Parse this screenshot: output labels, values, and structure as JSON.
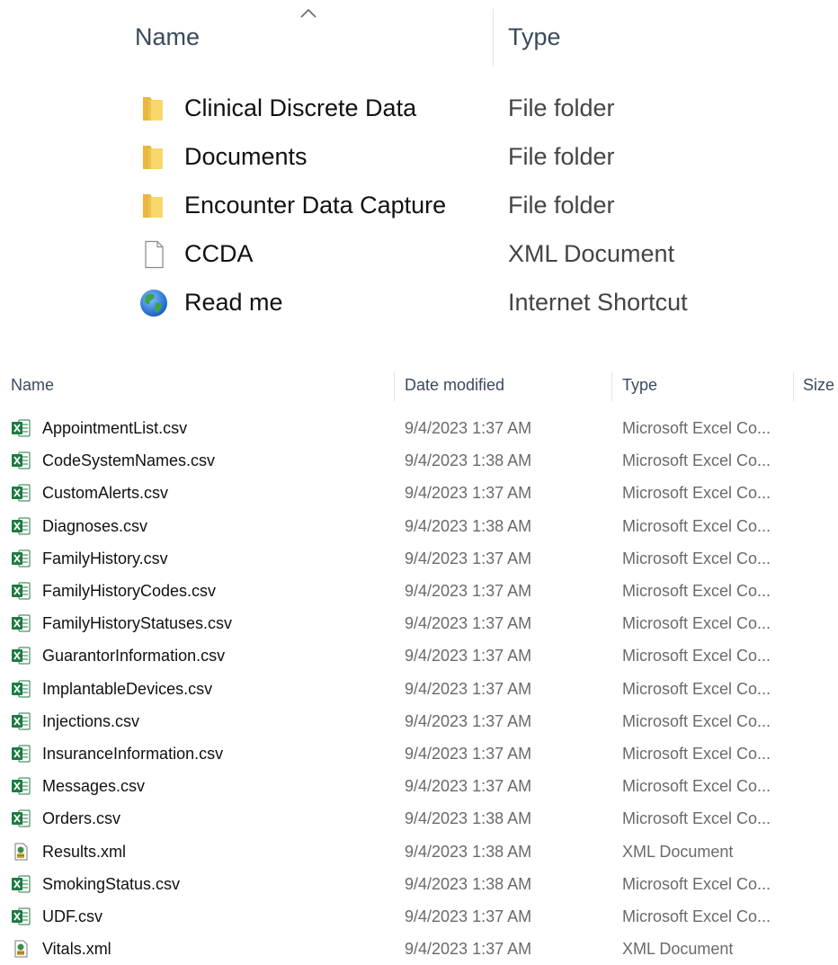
{
  "top_pane": {
    "columns": {
      "name": "Name",
      "type": "Type"
    },
    "sort_icon": "chevron-up-icon",
    "items": [
      {
        "name": "Clinical Discrete Data",
        "type": "File folder",
        "icon": "folder-icon"
      },
      {
        "name": "Documents",
        "type": "File folder",
        "icon": "folder-icon"
      },
      {
        "name": "Encounter Data Capture",
        "type": "File folder",
        "icon": "folder-icon"
      },
      {
        "name": "CCDA",
        "type": "XML Document",
        "icon": "blank-file-icon"
      },
      {
        "name": "Read me",
        "type": "Internet Shortcut",
        "icon": "globe-icon"
      }
    ]
  },
  "bottom_pane": {
    "columns": {
      "name": "Name",
      "date_modified": "Date modified",
      "type": "Type",
      "size": "Size"
    },
    "files": [
      {
        "name": "AppointmentList.csv",
        "date": "9/4/2023 1:37 AM",
        "type": "Microsoft Excel Co...",
        "icon": "excel-csv-icon"
      },
      {
        "name": "CodeSystemNames.csv",
        "date": "9/4/2023 1:38 AM",
        "type": "Microsoft Excel Co...",
        "icon": "excel-csv-icon"
      },
      {
        "name": "CustomAlerts.csv",
        "date": "9/4/2023 1:37 AM",
        "type": "Microsoft Excel Co...",
        "icon": "excel-csv-icon"
      },
      {
        "name": "Diagnoses.csv",
        "date": "9/4/2023 1:38 AM",
        "type": "Microsoft Excel Co...",
        "icon": "excel-csv-icon"
      },
      {
        "name": "FamilyHistory.csv",
        "date": "9/4/2023 1:37 AM",
        "type": "Microsoft Excel Co...",
        "icon": "excel-csv-icon"
      },
      {
        "name": "FamilyHistoryCodes.csv",
        "date": "9/4/2023 1:37 AM",
        "type": "Microsoft Excel Co...",
        "icon": "excel-csv-icon"
      },
      {
        "name": "FamilyHistoryStatuses.csv",
        "date": "9/4/2023 1:37 AM",
        "type": "Microsoft Excel Co...",
        "icon": "excel-csv-icon"
      },
      {
        "name": "GuarantorInformation.csv",
        "date": "9/4/2023 1:37 AM",
        "type": "Microsoft Excel Co...",
        "icon": "excel-csv-icon"
      },
      {
        "name": "ImplantableDevices.csv",
        "date": "9/4/2023 1:37 AM",
        "type": "Microsoft Excel Co...",
        "icon": "excel-csv-icon"
      },
      {
        "name": "Injections.csv",
        "date": "9/4/2023 1:37 AM",
        "type": "Microsoft Excel Co...",
        "icon": "excel-csv-icon"
      },
      {
        "name": "InsuranceInformation.csv",
        "date": "9/4/2023 1:37 AM",
        "type": "Microsoft Excel Co...",
        "icon": "excel-csv-icon"
      },
      {
        "name": "Messages.csv",
        "date": "9/4/2023 1:37 AM",
        "type": "Microsoft Excel Co...",
        "icon": "excel-csv-icon"
      },
      {
        "name": "Orders.csv",
        "date": "9/4/2023 1:38 AM",
        "type": "Microsoft Excel Co...",
        "icon": "excel-csv-icon"
      },
      {
        "name": "Results.xml",
        "date": "9/4/2023 1:38 AM",
        "type": "XML Document",
        "icon": "xml-file-icon"
      },
      {
        "name": "SmokingStatus.csv",
        "date": "9/4/2023 1:38 AM",
        "type": "Microsoft Excel Co...",
        "icon": "excel-csv-icon"
      },
      {
        "name": "UDF.csv",
        "date": "9/4/2023 1:37 AM",
        "type": "Microsoft Excel Co...",
        "icon": "excel-csv-icon"
      },
      {
        "name": "Vitals.xml",
        "date": "9/4/2023 1:37 AM",
        "type": "XML Document",
        "icon": "xml-file-icon"
      }
    ]
  }
}
